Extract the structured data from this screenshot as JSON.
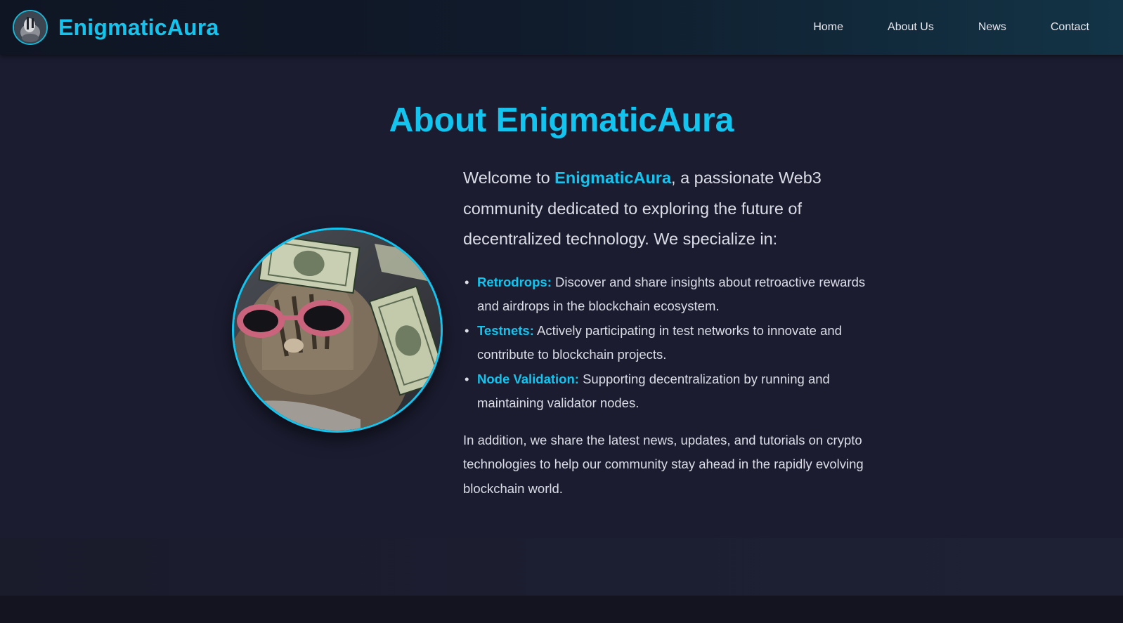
{
  "header": {
    "brand_name": "EnigmaticAura",
    "logo_icon": "cat-avatar-logo",
    "nav": [
      {
        "label": "Home"
      },
      {
        "label": "About Us"
      },
      {
        "label": "News"
      },
      {
        "label": "Contact"
      }
    ]
  },
  "about": {
    "title": "About EnigmaticAura",
    "photo_icon": "cat-with-sunglasses-and-dollars-image",
    "intro_prefix": "Welcome to ",
    "intro_highlight": "EnigmaticAura",
    "intro_suffix": ", a passionate Web3 community dedicated to exploring the future of decentralized technology. We specialize in:",
    "items": [
      {
        "term": "Retrodrops:",
        "text": " Discover and share insights about retroactive rewards and airdrops in the blockchain ecosystem."
      },
      {
        "term": "Testnets:",
        "text": " Actively participating in test networks to innovate and contribute to blockchain projects."
      },
      {
        "term": "Node Validation:",
        "text": " Supporting decentralization by running and maintaining validator nodes."
      }
    ],
    "outro": "In addition, we share the latest news, updates, and tutorials on crypto technologies to help our community stay ahead in the rapidly evolving blockchain world."
  },
  "colors": {
    "accent": "#12c4ee",
    "background": "#1b1c30",
    "header_start": "#0f1523",
    "header_end": "#123446",
    "text": "#dcdde6"
  }
}
